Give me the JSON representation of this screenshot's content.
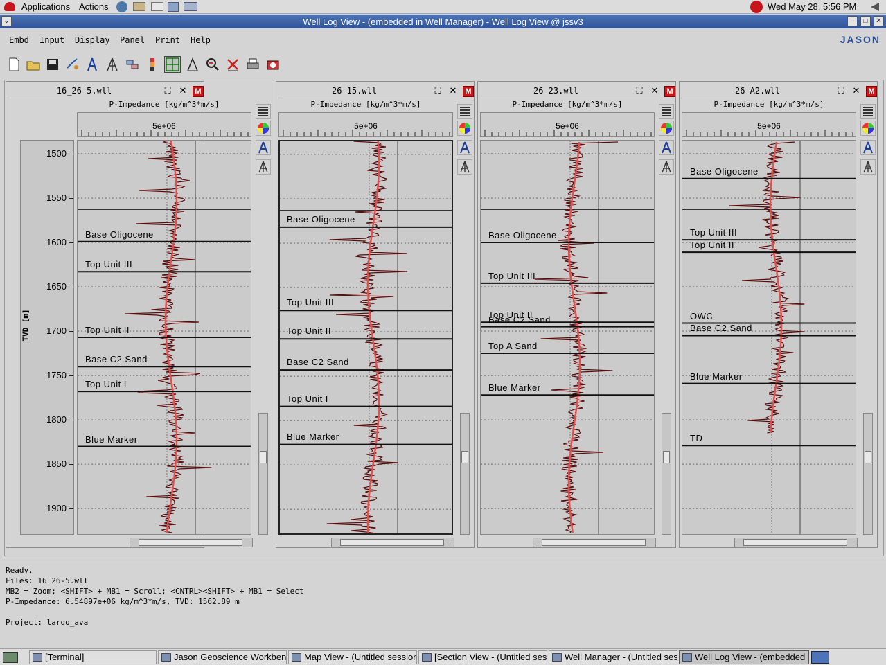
{
  "topbar": {
    "applications": "Applications",
    "actions": "Actions",
    "clock": "Wed May 28,  5:56 PM"
  },
  "window": {
    "title": "Well Log View - (embedded in Well Manager) - Well Log View @ jssv3"
  },
  "menubar": {
    "items": [
      {
        "label": "Embd",
        "name": "menu-embd"
      },
      {
        "label": "Input",
        "name": "menu-input"
      },
      {
        "label": "Display",
        "name": "menu-display"
      },
      {
        "label": "Panel",
        "name": "menu-panel"
      },
      {
        "label": "Print",
        "name": "menu-print"
      },
      {
        "label": "Help",
        "name": "menu-help"
      }
    ],
    "logo": "JASON"
  },
  "toolbar": {
    "tools": [
      "new-file-icon",
      "open-folder-icon",
      "save-icon",
      "link-icon",
      "well-icon",
      "well-split-icon",
      "layers-icon",
      "color-bar-icon",
      "crosshair-icon",
      "curve-icon",
      "zoom-out-icon",
      "delete-icon",
      "print-icon",
      "camera-icon"
    ],
    "selected": "crosshair-icon"
  },
  "depth_axis": {
    "label": "TVD [m]",
    "ticks": [
      "1500",
      "1550",
      "1600",
      "1650",
      "1700",
      "1750",
      "1800",
      "1850",
      "1900"
    ],
    "range": [
      1486,
      1928
    ]
  },
  "panels": [
    {
      "name": "16_26-5.wll",
      "curve": "P-Impedance [kg/m^3*m/s]",
      "tick": "5e+06",
      "horizons": [
        {
          "label": "Base  Oligocene",
          "depth": 1599
        },
        {
          "label": "Top  Unit  III",
          "depth": 1633
        },
        {
          "label": "Top  Unit  II",
          "depth": 1707
        },
        {
          "label": "Base  C2  Sand",
          "depth": 1740
        },
        {
          "label": "Top  Unit  I",
          "depth": 1768
        },
        {
          "label": "Blue  Marker",
          "depth": 1830
        }
      ]
    },
    {
      "name": "26-15.wll",
      "curve": "P-Impedance [kg/m^3*m/s]",
      "tick": "5e+06",
      "horizons": [
        {
          "label": "Base  Oligocene",
          "depth": 1582
        },
        {
          "label": "Top  Unit  III",
          "depth": 1676
        },
        {
          "label": "Top  Unit  II",
          "depth": 1708
        },
        {
          "label": "Base  C2  Sand",
          "depth": 1743
        },
        {
          "label": "Top  Unit  I",
          "depth": 1784
        },
        {
          "label": "Blue  Marker",
          "depth": 1827
        }
      ]
    },
    {
      "name": "26-23.wll",
      "curve": "P-Impedance [kg/m^3*m/s]",
      "tick": "5e+06",
      "horizons": [
        {
          "label": "Base  Oligocene",
          "depth": 1600
        },
        {
          "label": "Top  Unit  III",
          "depth": 1646
        },
        {
          "label": "Top  Unit  II",
          "depth": 1690
        },
        {
          "label": "Base  C2  Sand",
          "depth": 1695
        },
        {
          "label": "Top  A  Sand",
          "depth": 1725
        },
        {
          "label": "Blue  Marker",
          "depth": 1772
        }
      ]
    },
    {
      "name": "26-A2.wll",
      "curve": "P-Impedance [kg/m^3*m/s]",
      "tick": "5e+06",
      "horizons": [
        {
          "label": "Base  Oligocene",
          "depth": 1528
        },
        {
          "label": "Top  Unit  III",
          "depth": 1597
        },
        {
          "label": "Top  Unit  II",
          "depth": 1611
        },
        {
          "label": "OWC",
          "depth": 1691
        },
        {
          "label": "Base  C2  Sand",
          "depth": 1705
        },
        {
          "label": "Blue  Marker",
          "depth": 1759
        },
        {
          "label": "TD",
          "depth": 1829
        }
      ]
    }
  ],
  "status": {
    "line1": "Ready.",
    "line2": "Files: 16_26-5.wll",
    "line3": "MB2 = Zoom; <SHIFT> + MB1 = Scroll; <CNTRL><SHIFT> + MB1 = Select",
    "line4": "P-Impedance: 6.54897e+06 kg/m^3*m/s, TVD: 1562.89 m",
    "line5": "",
    "line6": "Project: largo_ava"
  },
  "taskbar": {
    "items": [
      {
        "label": "[Terminal]",
        "active": false
      },
      {
        "label": "Jason Geoscience Workbench",
        "active": false
      },
      {
        "label": "Map View - (Untitled session)",
        "active": false
      },
      {
        "label": "[Section View - (Untitled session)]",
        "active": false
      },
      {
        "label": "Well Manager - (Untitled session)",
        "active": false
      },
      {
        "label": "Well Log View - (embedded",
        "active": true
      }
    ]
  },
  "colors": {
    "log": "#5a0a0a",
    "trend": "#e05050",
    "title_bar": "#3a5fa6"
  }
}
